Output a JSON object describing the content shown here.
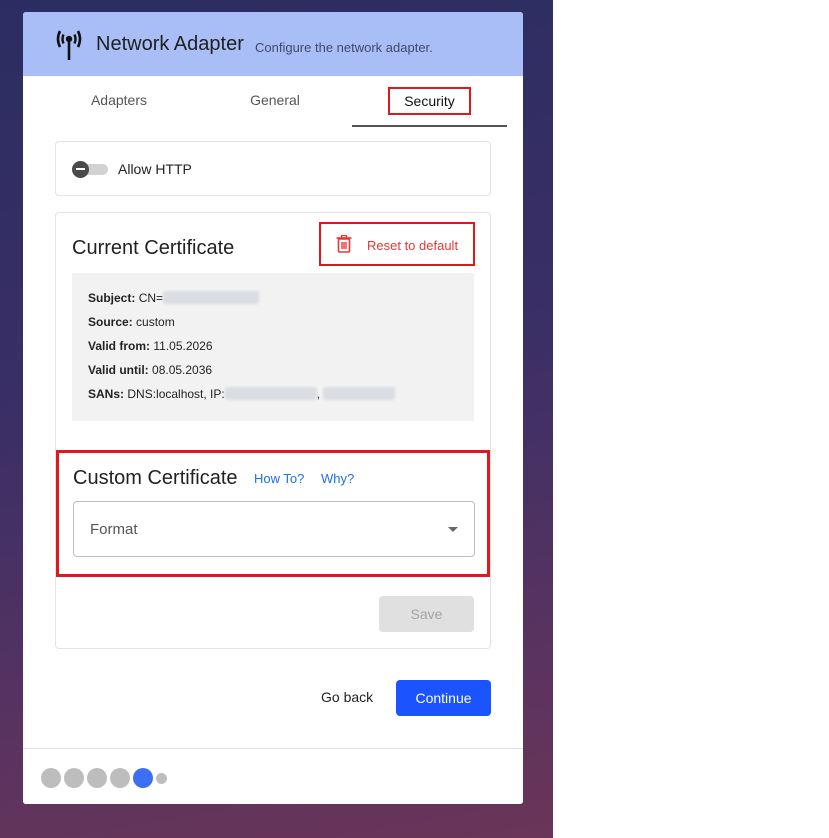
{
  "header": {
    "title": "Network Adapter",
    "subtitle": "Configure the network adapter.",
    "icon": "antenna-icon"
  },
  "tabs": [
    {
      "label": "Adapters",
      "active": false
    },
    {
      "label": "General",
      "active": false
    },
    {
      "label": "Security",
      "active": true
    }
  ],
  "http": {
    "label": "Allow HTTP",
    "enabled": false
  },
  "current_certificate": {
    "title": "Current Certificate",
    "reset_label": "Reset to default",
    "subject_label": "Subject:",
    "subject_prefix": "CN=",
    "source_label": "Source:",
    "source_value": "custom",
    "valid_from_label": "Valid from:",
    "valid_from_value": "11.05.2026",
    "valid_until_label": "Valid until:",
    "valid_until_value": "08.05.2036",
    "sans_label": "SANs:",
    "sans_prefix": "DNS:localhost, IP:",
    "sans_separator": ","
  },
  "custom_certificate": {
    "title": "Custom Certificate",
    "howto_label": "How To?",
    "why_label": "Why?",
    "format_label": "Format",
    "save_label": "Save"
  },
  "actions": {
    "goback_label": "Go back",
    "continue_label": "Continue"
  },
  "progress": {
    "total_steps": 6,
    "current_step": 5
  },
  "colors": {
    "header_bg": "#a9bdf7",
    "accent": "#1a53ff",
    "danger": "#e53935",
    "link": "#1a73e8"
  }
}
